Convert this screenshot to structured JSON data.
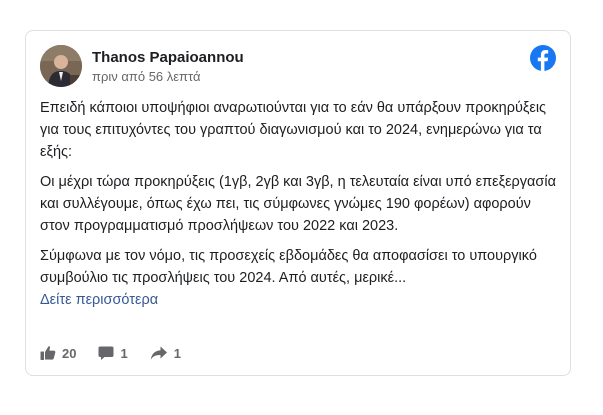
{
  "post": {
    "author": "Thanos Papaioannou",
    "timestamp": "πριν από 56 λεπτά",
    "paragraphs": [
      "Επειδή κάποιοι υποψήφιοι αναρωτιούνται για το εάν θα υπάρξουν προκηρύξεις για τους επιτυχόντες του γραπτού διαγωνισμού και το 2024, ενημερώνω για τα εξής:",
      "Οι μέχρι τώρα προκηρύξεις (1γβ, 2γβ και 3γβ, η τελευταία είναι υπό επεξεργασία και συλλέγουμε, όπως έχω πει, τις σύμφωνες γνώμες 190 φορέων) αφορούν στον προγραμματισμό προσλήψεων του 2022 και 2023.",
      "Σύμφωνα με τον νόμο, τις προσεχείς εβδομάδες θα αποφασίσει το υπουργικό συμβούλιο τις προσλήψεις του 2024. Από αυτές, μερικέ..."
    ],
    "see_more": "Δείτε περισσότερα"
  },
  "footer": {
    "likes": "20",
    "comments": "1",
    "shares": "1"
  },
  "colors": {
    "facebook_blue": "#1877f2",
    "link": "#385898",
    "muted": "#65676b"
  },
  "icons": {
    "logo": "facebook-logo-icon",
    "like": "thumbs-up-icon",
    "comment": "comment-icon",
    "share": "share-arrow-icon"
  }
}
